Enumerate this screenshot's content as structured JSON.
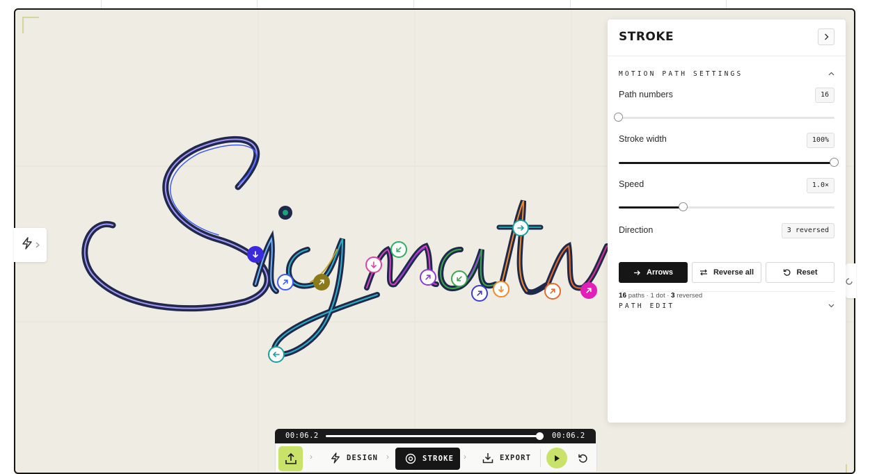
{
  "panel": {
    "title": "STROKE",
    "motion_section": "MOTION PATH SETTINGS",
    "path_numbers": {
      "label": "Path numbers",
      "value": "16",
      "level": 0.0
    },
    "stroke_width": {
      "label": "Stroke width",
      "value": "100%",
      "level": 1.0
    },
    "speed": {
      "label": "Speed",
      "value": "1.0×",
      "level": 0.3
    },
    "direction": {
      "label": "Direction",
      "badge": "3 reversed",
      "buttons": [
        "Arrows",
        "Reverse all",
        "Reset"
      ],
      "active": "Arrows"
    },
    "summary": {
      "paths_count": "16",
      "paths_word": "paths · 1 dot ·",
      "reversed_count": "3",
      "reversed_word": "reversed"
    },
    "path_edit_section": "PATH EDIT"
  },
  "timeline": {
    "current_time": "00:06.2",
    "total_time": "00:06.2",
    "progress": 1.0
  },
  "toolbar": {
    "design_label": "DESIGN",
    "stroke_label": "STROKE",
    "export_label": "EXPORT",
    "active_step": "STROKE"
  },
  "icons": {
    "tool_tab": "bolt-icon",
    "tool_tab_chevron": "chevron-right-icon",
    "panel_collapse": "chevron-right-icon",
    "motion_toggle": "chevron-up-icon",
    "path_edit_toggle": "chevron-down-icon",
    "export": "upload-icon",
    "design": "bolt-icon",
    "stroke": "target-icon",
    "download": "download-icon",
    "play": "play-icon",
    "reset": "rotate-ccw-icon"
  },
  "colors": {
    "accent": "#c9e36a",
    "ink": "#1f2a4a",
    "canvas": "#efece3",
    "path_colors": [
      "#3b5bff",
      "#2bb0c9",
      "#c9a227",
      "#e040c8",
      "#8b3bd9",
      "#3aa84b",
      "#1a8f5a",
      "#f08a2a",
      "#e86a2a",
      "#e020b8",
      "#1aa0a0",
      "#3a2ad9"
    ]
  },
  "markers": [
    {
      "kind": "dot",
      "color": "#1aa47a"
    },
    {
      "kind": "arrow",
      "dir": "down",
      "color": "#3a2ad9",
      "filled": true
    },
    {
      "kind": "arrow",
      "dir": "up-right",
      "color": "#3b5bff"
    },
    {
      "kind": "arrow",
      "dir": "up-right",
      "color": "#8a7a1a",
      "filled": true
    },
    {
      "kind": "arrow",
      "dir": "down",
      "color": "#e040a8"
    },
    {
      "kind": "arrow",
      "dir": "down-left",
      "color": "#2ab060"
    },
    {
      "kind": "arrow",
      "dir": "up-right",
      "color": "#8b3bd9"
    },
    {
      "kind": "arrow",
      "dir": "down-left",
      "color": "#3aa84b"
    },
    {
      "kind": "arrow",
      "dir": "right",
      "color": "#1aa0a0"
    },
    {
      "kind": "arrow",
      "dir": "up-right",
      "color": "#3a3ad9"
    },
    {
      "kind": "arrow",
      "dir": "down",
      "color": "#f08a2a"
    },
    {
      "kind": "arrow",
      "dir": "up-right",
      "color": "#e86a2a"
    },
    {
      "kind": "arrow",
      "dir": "up-right",
      "color": "#e020b8",
      "filled": true
    },
    {
      "kind": "arrow",
      "dir": "left",
      "color": "#1aa0a0"
    }
  ]
}
